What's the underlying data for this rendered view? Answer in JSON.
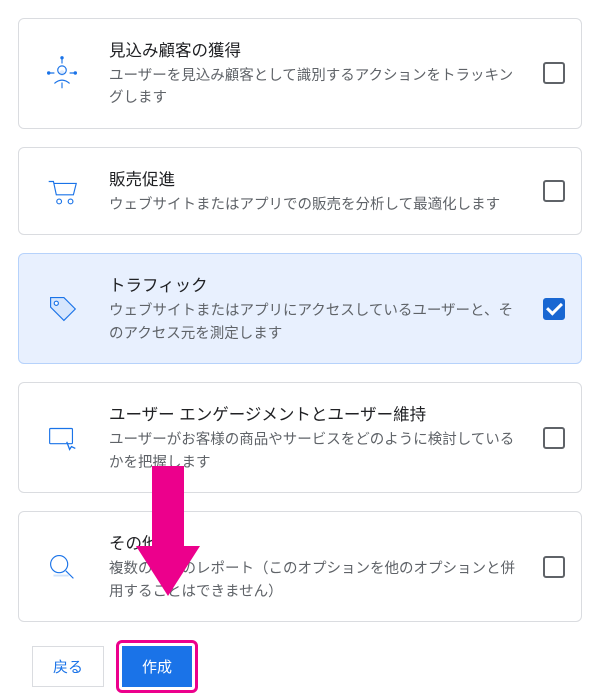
{
  "options": [
    {
      "id": "lead",
      "title": "見込み顧客の獲得",
      "desc": "ユーザーを見込み顧客として識別するアクションをトラッキングします",
      "selected": false
    },
    {
      "id": "sales",
      "title": "販売促進",
      "desc": "ウェブサイトまたはアプリでの販売を分析して最適化します",
      "selected": false
    },
    {
      "id": "traffic",
      "title": "トラフィック",
      "desc": "ウェブサイトまたはアプリにアクセスしているユーザーと、そのアクセス元を測定します",
      "selected": true
    },
    {
      "id": "engagement",
      "title": "ユーザー エンゲージメントとユーザー維持",
      "desc": "ユーザーがお客様の商品やサービスをどのように検討しているかを把握します",
      "selected": false
    },
    {
      "id": "other",
      "title": "その他",
      "desc": "複数の種類のレポート（このオプションを他のオプションと併用することはできません）",
      "selected": false
    }
  ],
  "footer": {
    "back_label": "戻る",
    "create_label": "作成"
  },
  "colors": {
    "primary": "#1a73e8",
    "selected_bg": "#e8f0fe",
    "annotation": "#ec008c"
  }
}
